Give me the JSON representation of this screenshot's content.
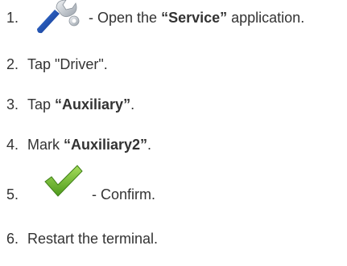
{
  "steps": [
    {
      "num": "1.",
      "text": " - Open the ",
      "highlight": "“Service”",
      "text_after": " application.",
      "icon": "wrench-icon"
    },
    {
      "num": "2.",
      "text": "Tap \"Driver\"."
    },
    {
      "num": "3.",
      "text_before": "Tap ",
      "highlight": "“Auxiliary”",
      "text_after": "."
    },
    {
      "num": "4.",
      "text_before": "Mark ",
      "highlight": "“Auxiliary2”",
      "text_after": "."
    },
    {
      "num": "5.",
      "text": " - Confirm.",
      "icon": "checkmark-icon"
    },
    {
      "num": "6.",
      "text": "Restart the terminal."
    }
  ],
  "colors": {
    "text": "#333333",
    "wrench_handle": "#1b4fb8",
    "wrench_head": "#c9ced4",
    "check_green": "#7cc23a"
  }
}
